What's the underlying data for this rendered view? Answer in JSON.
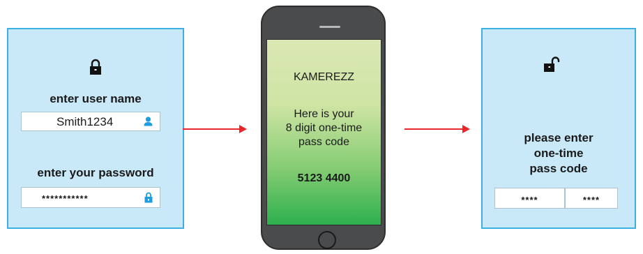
{
  "login": {
    "username_label": "enter user name",
    "username_value": "Smith1234",
    "password_label": "enter your password",
    "password_value": "***********"
  },
  "phone": {
    "sender": "KAMEREZZ",
    "message_line1": "Here is your",
    "message_line2": "8 digit one-time",
    "message_line3": "pass code",
    "code": "5123 4400"
  },
  "otp": {
    "prompt_line1": "please enter",
    "prompt_line2": "one-time",
    "prompt_line3": "pass code",
    "box1": "****",
    "box2": "****"
  },
  "colors": {
    "panel_fill": "#c9e9f8",
    "panel_border": "#3eb1e4",
    "arrow": "#e8262b",
    "phone_body": "#4a4b4c",
    "screen_top": "#dbe8b5",
    "screen_bottom": "#2db04e",
    "icon_blue": "#1a9ee0"
  },
  "icons": [
    "lock-closed-icon",
    "user-icon",
    "small-lock-icon",
    "lock-open-icon"
  ]
}
